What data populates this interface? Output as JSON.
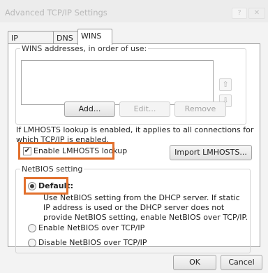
{
  "window": {
    "title": "Advanced TCP/IP Settings",
    "help_label": "?",
    "close_label": "✕"
  },
  "tabs": [
    {
      "label": "IP Settings",
      "active": false
    },
    {
      "label": "DNS",
      "active": false
    },
    {
      "label": "WINS",
      "active": true
    }
  ],
  "wins": {
    "group_label": "WINS addresses, in order of use:",
    "addresses": [],
    "up_arrow": "⇧",
    "down_arrow": "⇩",
    "add_label": "Add...",
    "edit_label": "Edit...",
    "remove_label": "Remove"
  },
  "lmhosts": {
    "description": "If LMHOSTS lookup is enabled, it applies to all connections for which TCP/IP is enabled.",
    "checkbox_label": "Enable LMHOSTS lookup",
    "checked": true,
    "import_label": "Import LMHOSTS..."
  },
  "netbios": {
    "group_label": "NetBIOS setting",
    "default_label": "Default:",
    "default_description": "Use NetBIOS setting from the DHCP server. If static IP address is used or the DHCP server does not provide NetBIOS setting, enable NetBIOS over TCP/IP.",
    "enable_label": "Enable NetBIOS over TCP/IP",
    "disable_label": "Disable NetBIOS over TCP/IP",
    "selected": "default"
  },
  "footer": {
    "ok_label": "OK",
    "cancel_label": "Cancel"
  },
  "colors": {
    "highlight": "#e2702d"
  }
}
